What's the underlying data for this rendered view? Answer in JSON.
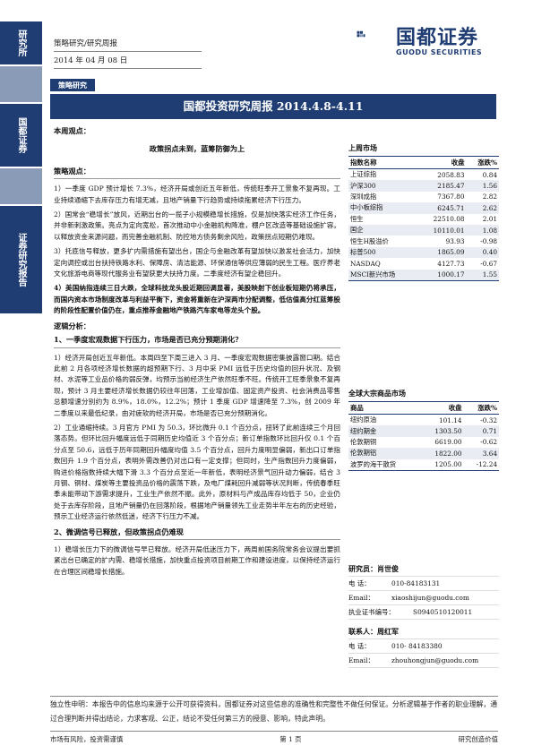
{
  "sidebar": {
    "labels": [
      "研究所",
      "国都证券",
      "证券研究报告"
    ],
    "colors": [
      "#1f3c73",
      "#8a9bb8",
      "#1f3c73",
      "#8a9bb8",
      "#1f3c73"
    ]
  },
  "header": {
    "category": "策略研究/研究周报",
    "date": "2014 年 04 月 08 日",
    "logo_cn": "国都证券",
    "logo_en": "GUODU SECURITIES",
    "tag": "策略研究",
    "title": "国都投资研究周报 2014.4.8-4.11"
  },
  "main": {
    "weekly_view_label": "本周观点：",
    "weekly_title": "政策拐点未到，蓝筹防御为上",
    "strategy_label": "策略观点：",
    "points": [
      "1）一季度 GDP 预计增长 7.3%，经济开局或创近五年新低，传统旺季开工景象不复再现。工业持续通缩下去库存压力有增无减，且地产销量下行趋势或持续拖累经济下行压力。",
      "2）国常会“稳增长”放风，近期出台的一揽子小规模稳增长措施，仅是加快落实经济工作任务，并非新刺激政策。亮点为定向宽松，首次推动中小金融机构降准，棚户区改造等基础设施扩容。以释放资金来源问题，而完善金融机制、防控地方债务剩余风险，政策拐点短期仍难现。",
      "3）托底信号释放，更多扩内需措施有望出台，国企与金融改革有望加快以激发社会活力，加快定向调控或出台扶持铁路水利、保障房、清洁能源、环保通信等供应薄弱的民生工程。医疗养老文化旅游电商等现代服务业有望获更大扶持力度。二季度经济有望企稳回升。",
      "4）美国纳指连续三日大跌，全球科技龙头股近期回调显著，美股映射下创业板短期仍将承压，而国内资本市场制度改革与利益平衡下，资金将重新在沪深两市分配调整，低估值高分红蓝筹股的阶段性配置价值仍在，重点推荐金融地产铁路汽车家电等龙头个股。"
    ],
    "logic_label": "逻辑分析：",
    "section1_title": "1、一季度宏观数据下行压力，市场是否已充分预期消化？",
    "section1_body": [
      "1）经济开局创近五年新低。本周四至下周三进入 3 月、一季度宏观数据密集披露窗口期。结合此前 2 月各项经济增长数据的超预期下行、3 月中采 PMI 远低于历史均值的回升状况、及钢材、水泥等工业品价格的弱反弹，均预示当前经济生产依然旺季不旺。传统开工旺季景象不复再现，预计 3 月主要经济增长数据仍较往年回落，工业增加值、固定资产投资、社会消费品零售总额增速分别约为 8.9%，18.0%，12.2%；预计 1 季度 GDP 增速降至 7.3%，创 2009 年二季度以来最低纪录，由对疲软的经济开局，市场是否已充分预期消化。",
      "2）工业通缩持续。3 月官方 PMI 为 50.3，环比微升 0.1 个百分点，扭转了此前连续三个月回落态势。但环比回升幅度远低于同期历史均值近 3 个百分点；新订单指数环比回升仅 0.1 个百分点至 50.6，远低于历年同期回升幅度均值 3.5 个百分点，回升力度明显偏弱，新出口订单指数回升 1.9 个百分点，表明外需改善仍对出口有一定支撑；但同时，生产指数回升力度偏弱，购进价格指数持续大幅下滑 3.3 个百分点至近一年新低，表明经济景气回升动力偏弱，结合 3 月钢、铜材、煤炭等主要投资品价格的震荡下跌，及电厂煤耗回升减弱等状况判断，传统春季旺季未能带动下游需求提升，工业生产依然不振。此外，原材料与产成品库存均低于 50，企业仍处于去库存阶段，且地产销量仍在回落阶段，根据地产销量领先工业走势半年左右的历史经验，预示工业经济运行依然低迷，经济下行压力不减。"
    ],
    "section2_title": "2、微调信号已释放，但政策拐点仍难现",
    "section2_body": "1）稳增长压力下的微调信号早已释放。经济开局低迷压力下，两周前国务院常务会议提出要抓紧出台已确定的扩内需、稳增长措施，加快重点投资项目前期工作和建设进度，以保持经济运行在合理区间稳增长措施。"
  },
  "market": {
    "title": "上周市场",
    "headers": [
      "指数名称",
      "收盘",
      "涨跌%"
    ],
    "rows": [
      [
        "上证综指",
        "2058.83",
        "0.84"
      ],
      [
        "沪深300",
        "2185.47",
        "1.56"
      ],
      [
        "深圳成指",
        "7367.80",
        "2.82"
      ],
      [
        "中小板综指",
        "6245.71",
        "2.62"
      ],
      [
        "恒生",
        "22510.08",
        "2.01"
      ],
      [
        "国企",
        "10110.01",
        "1.08"
      ],
      [
        "恒生H股溢价",
        "93.93",
        "-0.98"
      ],
      [
        "标普500",
        "1865.09",
        "0.40"
      ],
      [
        "NASDAQ",
        "4127.73",
        "-0.67"
      ],
      [
        "MSCI新兴市场",
        "1000.17",
        "1.55"
      ]
    ]
  },
  "commodity": {
    "title": "全球大宗商品市场",
    "headers": [
      "商品",
      "收盘",
      "涨跌%"
    ],
    "rows": [
      [
        "纽约原油",
        "101.14",
        "-0.32"
      ],
      [
        "纽约期金",
        "1303.50",
        "0.71"
      ],
      [
        "伦敦期铜",
        "6619.00",
        "-0.62"
      ],
      [
        "伦敦期铝",
        "1822.00",
        "3.64"
      ],
      [
        "波罗的海干散货",
        "1205.00",
        "-12.24"
      ]
    ]
  },
  "analyst": {
    "label": "研究员：",
    "name": "肖世俊",
    "rows": [
      [
        "电 话：",
        "010-84183131"
      ],
      [
        "Email：",
        "xiaoshijun@guodu.com"
      ],
      [
        "执业证书编号：",
        "S0940510120011"
      ]
    ],
    "contact_label": "联系人：",
    "contact_name": "周红军",
    "contact_rows": [
      [
        "电 话：",
        "010- 84183380"
      ],
      [
        "Email：",
        "zhouhongjun@guodu.com"
      ]
    ]
  },
  "disclaimer": "独立性申明：本报告中的信息均来源于公开可获得资料，国都证券对这些信息的准确性和完整性不做任何保证。分析逻辑基于作者的职业理解，通过合理判断并得出结论，力求客观、公正，结论不受任何第三方的授意、影响，特此声明。",
  "footer": {
    "left": "市场有风险，投资需谨慎",
    "center": "第 1 页",
    "right": "研究创造价值"
  }
}
